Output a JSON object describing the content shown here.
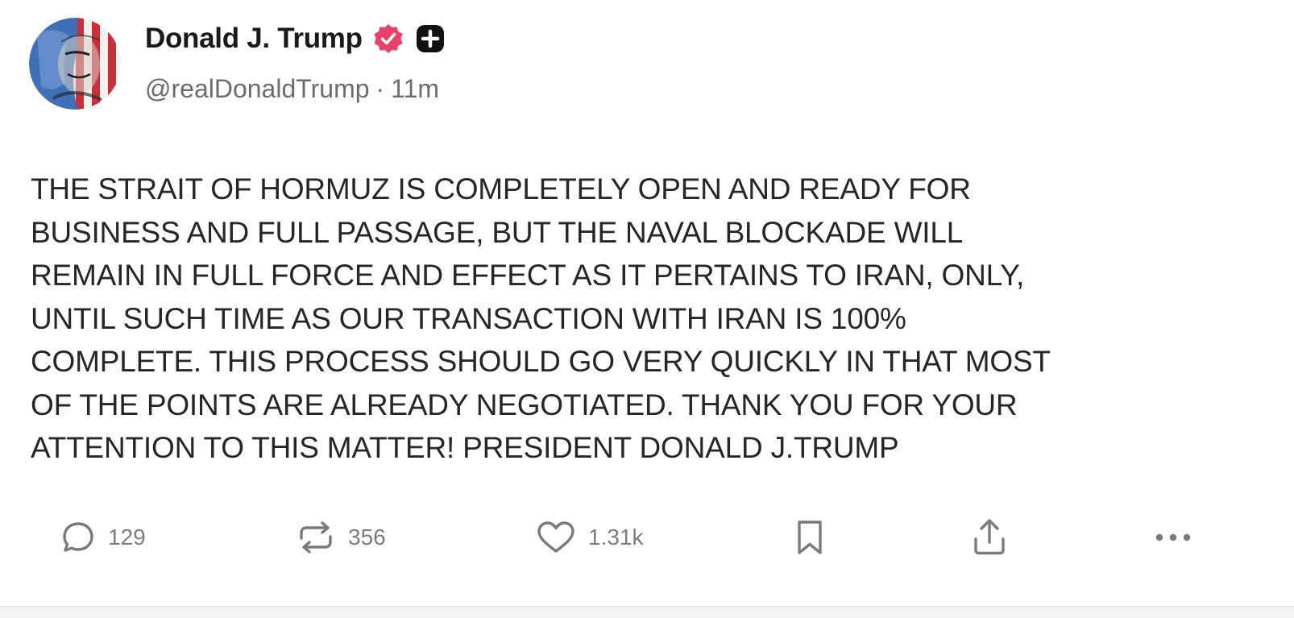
{
  "author": {
    "display_name": "Donald J. Trump",
    "handle": "@realDonaldTrump",
    "separator": "·",
    "time_ago": "11m",
    "verified_icon": "verified-badge-icon",
    "plus_icon": "plus-badge-icon",
    "verified_color": "#e8426b"
  },
  "post": {
    "text": "THE STRAIT OF HORMUZ IS COMPLETELY OPEN AND READY FOR\nBUSINESS AND FULL PASSAGE, BUT THE NAVAL BLOCKADE WILL\nREMAIN IN FULL FORCE AND EFFECT AS IT PERTAINS TO IRAN, ONLY,\nUNTIL SUCH TIME AS OUR TRANSACTION WITH IRAN IS 100%\nCOMPLETE. THIS PROCESS SHOULD GO VERY QUICKLY IN THAT MOST\nOF THE POINTS ARE ALREADY NEGOTIATED. THANK YOU FOR YOUR\nATTENTION TO THIS MATTER! PRESIDENT DONALD J.TRUMP"
  },
  "actions": {
    "reply": {
      "icon": "reply-icon",
      "count": "129"
    },
    "repost": {
      "icon": "repost-icon",
      "count": "356"
    },
    "like": {
      "icon": "heart-icon",
      "count": "1.31k"
    },
    "bookmark": {
      "icon": "bookmark-icon"
    },
    "share": {
      "icon": "share-icon"
    },
    "more": {
      "icon": "more-icon"
    }
  }
}
